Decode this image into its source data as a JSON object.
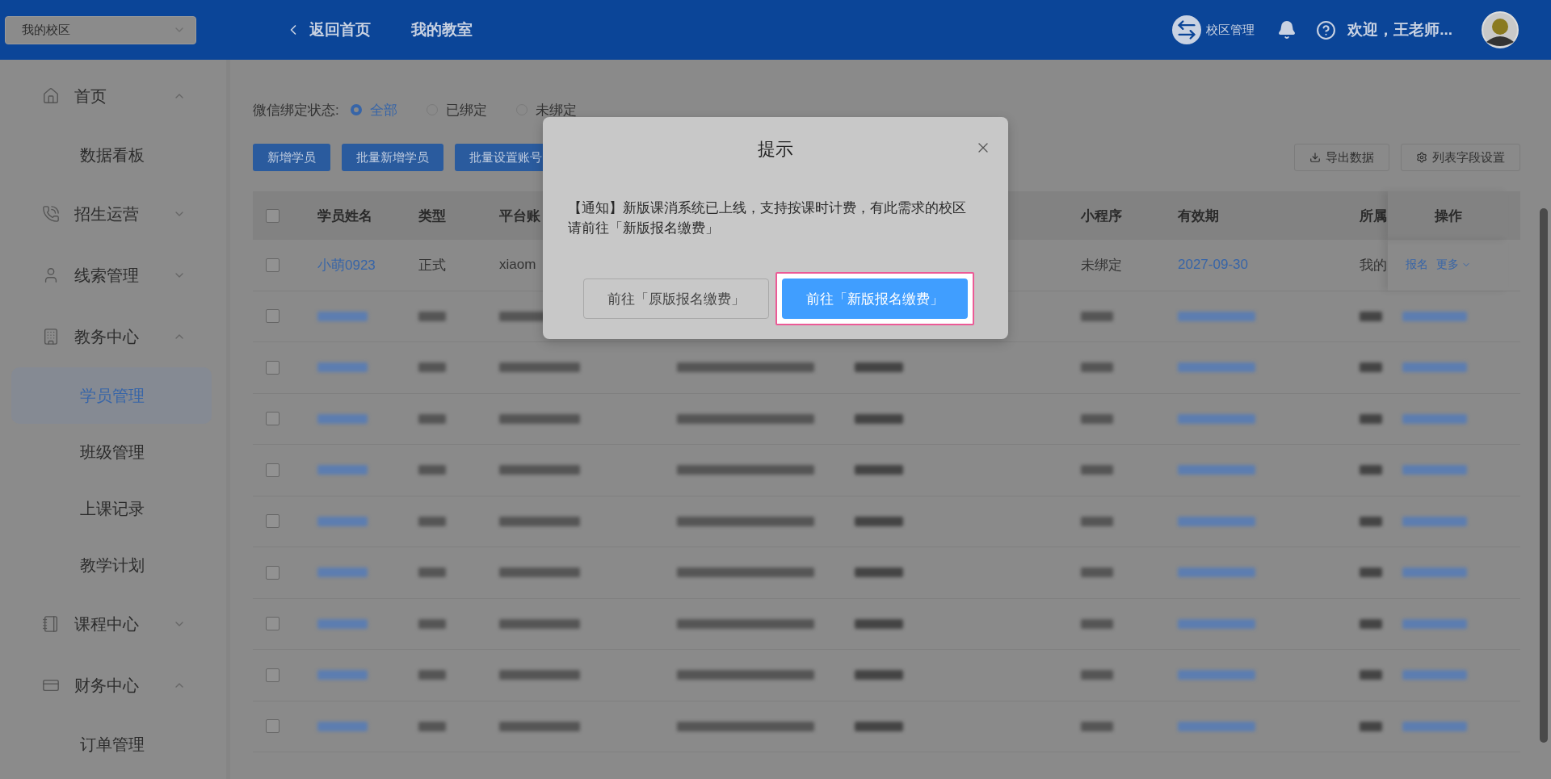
{
  "header": {
    "campus_select": "我的校区",
    "nav": [
      {
        "label": "返回首页",
        "kind": "back"
      },
      {
        "label": "我的教室",
        "kind": "link"
      }
    ],
    "campus_manage": "校区管理",
    "welcome": "欢迎，王老师..."
  },
  "sidebar": {
    "items": [
      {
        "label": "首页",
        "kind": "home",
        "expanded": true,
        "children": [
          {
            "label": "数据看板",
            "selected": false
          }
        ]
      },
      {
        "label": "招生运营",
        "kind": "phone",
        "expanded": false
      },
      {
        "label": "线索管理",
        "kind": "user",
        "expanded": false
      },
      {
        "label": "教务中心",
        "kind": "building",
        "expanded": true,
        "children": [
          {
            "label": "学员管理",
            "selected": true
          },
          {
            "label": "班级管理",
            "selected": false
          },
          {
            "label": "上课记录",
            "selected": false
          },
          {
            "label": "教学计划",
            "selected": false
          }
        ]
      },
      {
        "label": "课程中心",
        "kind": "notebook",
        "expanded": false
      },
      {
        "label": "财务中心",
        "kind": "card",
        "expanded": true,
        "children": [
          {
            "label": "订单管理",
            "selected": false
          }
        ]
      }
    ]
  },
  "filters": [
    {
      "label": "微信绑定状态:",
      "options": [
        {
          "label": "全部",
          "selected": true
        },
        {
          "label": "已绑定",
          "selected": false
        },
        {
          "label": "未绑定",
          "selected": false
        }
      ]
    }
  ],
  "toolbar": {
    "left": [
      "新增学员",
      "批量新增学员",
      "批量设置账号"
    ],
    "right": [
      {
        "label": "导出数据",
        "kind": "download"
      },
      {
        "label": "列表字段设置",
        "kind": "settings"
      }
    ]
  },
  "table": {
    "select_all_checked": false,
    "columns": [
      "学员姓名",
      "类型",
      "平台账",
      "小程序",
      "有效期",
      "所属",
      "操作"
    ],
    "rows": [
      {
        "kind": "data",
        "checked": false,
        "cells": [
          "小萌0923",
          "正式",
          "xiaom",
          "未绑定",
          "2027-09-30",
          "我的"
        ],
        "actions": [
          "报名",
          "更多"
        ]
      },
      {
        "kind": "blurred",
        "checked": false
      },
      {
        "kind": "blurred",
        "checked": false
      },
      {
        "kind": "blurred",
        "checked": false
      },
      {
        "kind": "blurred",
        "checked": false
      },
      {
        "kind": "blurred",
        "checked": false
      },
      {
        "kind": "blurred",
        "checked": false
      },
      {
        "kind": "blurred",
        "checked": false
      },
      {
        "kind": "blurred",
        "checked": false
      },
      {
        "kind": "blurred",
        "checked": false
      }
    ]
  },
  "modal": {
    "title": "提示",
    "message": "【通知】新版课消系统已上线，支持按课时计费，有此需求的校区请前往「新版报名缴费」",
    "buttons": [
      {
        "label": "前往「原版报名缴费」",
        "kind": "default",
        "highlighted": false
      },
      {
        "label": "前往「新版报名缴费」",
        "kind": "primary",
        "highlighted": true
      }
    ]
  }
}
